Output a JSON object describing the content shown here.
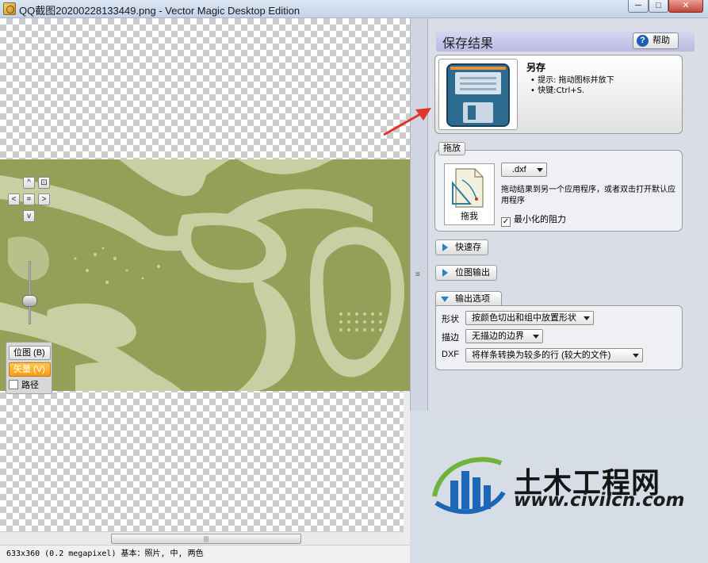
{
  "window": {
    "title": "QQ截图20200228133449.png - Vector Magic Desktop Edition",
    "min_glyph": "─",
    "max_glyph": "□",
    "close_glyph": "✕"
  },
  "canvas": {
    "colors": {
      "olive": "#959f57",
      "light": "#c9cfa2"
    },
    "nav": {
      "up": "^",
      "down": "v",
      "left": "<",
      "right": ">",
      "fit": "⌗",
      "center": "⊡"
    },
    "view_buttons": {
      "bitmap": "位图 (B)",
      "vector": "矢量 (V)",
      "path": "路径"
    },
    "vector_active": true,
    "path_checked": false
  },
  "status_bar": {
    "text": "633x360 (0.2 megapixel)  基本：照片, 中, 两色"
  },
  "scrollbar": {
    "grip": "|||"
  },
  "panel": {
    "title": "保存结果",
    "help_label": "帮助",
    "save": {
      "title": "另存",
      "hint1": "• 提示: 拖动图标并放下",
      "hint2": "• 快键:Ctrl+S."
    },
    "drag_group": {
      "label": "拖放",
      "format": ".dxf",
      "description": "拖动结果到另一个应用程序，或者双击打开默认应用程序",
      "icon_caption": "拖我",
      "min_resistance_label": "最小化的阻力",
      "min_resistance_checked": true
    },
    "quick_save_label": "快速存",
    "bitmap_output_label": "位图输出",
    "output_options": {
      "tab_label": "输出选项",
      "shape_label": "形状",
      "shape_value": "按颜色切出和组中放置形状",
      "stroke_label": "描边",
      "stroke_value": "无描边的边界",
      "dxf_label": "DXF",
      "dxf_value": "将样条转换为较多的行 (较大的文件)"
    }
  },
  "watermark": {
    "title": "土木工程网",
    "url": "www.civilcn.com",
    "colors": {
      "blue": "#1c67b7",
      "green": "#6fb33b"
    }
  },
  "splitter": {
    "grip": "≡"
  }
}
